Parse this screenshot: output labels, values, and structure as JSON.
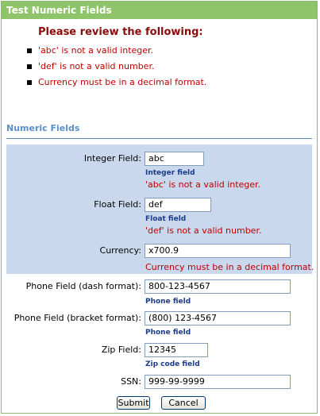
{
  "window": {
    "title": "Test Numeric Fields"
  },
  "errors": {
    "heading": "Please review the following:",
    "items": [
      "'abc' is not a valid integer.",
      "'def' is not a valid number.",
      "Currency must be in a decimal format."
    ]
  },
  "section": {
    "title": "Numeric Fields"
  },
  "fields": {
    "integer": {
      "label": "Integer Field:",
      "value": "abc",
      "hint": "Integer field",
      "error": "'abc' is not a valid integer."
    },
    "float": {
      "label": "Float Field:",
      "value": "def",
      "hint": "Float field",
      "error": "'def' is not a valid number."
    },
    "currency": {
      "label": "Currency:",
      "value": "x700.9",
      "error": "Currency must be in a decimal format."
    },
    "phone_dash": {
      "label": "Phone Field (dash format):",
      "value": "800-123-4567",
      "hint": "Phone field"
    },
    "phone_bracket": {
      "label": "Phone Field (bracket format):",
      "value": "(800) 123-4567",
      "hint": "Phone field"
    },
    "zip": {
      "label": "Zip Field:",
      "value": "12345",
      "hint": "Zip code field"
    },
    "ssn": {
      "label": "SSN:",
      "value": "999-99-9999"
    }
  },
  "buttons": {
    "submit": "Submit",
    "cancel": "Cancel"
  },
  "colors": {
    "title_bar": "#8fc46a",
    "error_text": "#c00000",
    "section_title": "#5a8fc8",
    "error_area": "#c9d8ec"
  }
}
